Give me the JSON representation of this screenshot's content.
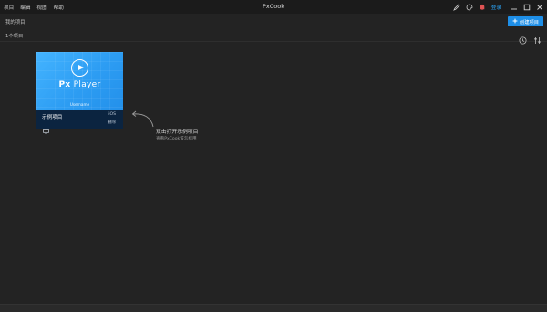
{
  "menu": [
    {
      "label": "项目"
    },
    {
      "label": "编辑"
    },
    {
      "label": "视图"
    },
    {
      "label": "帮助"
    }
  ],
  "window": {
    "title": "PxCook",
    "login_label": "登录"
  },
  "header": {
    "my_projects": "我的项目",
    "create_button": "创建项目"
  },
  "toolbar": {
    "count": "1个项目"
  },
  "project": {
    "thumb_title_bold": "Px",
    "thumb_title_rest": " Player",
    "thumb_subtitle": "Username",
    "name": "示例项目",
    "platform": "iOS",
    "delete": "删除"
  },
  "hint": {
    "title": "双击打开示例项目",
    "subtitle": "查看PxCook该怎样用"
  },
  "colors": {
    "accent": "#1e8fe8",
    "login": "#2aa2f4",
    "background": "#232323",
    "titlebar": "#1b1b1b",
    "card_footer": "#0b2440"
  },
  "icons": {
    "pen": "pen-icon",
    "palette": "palette-icon",
    "bell": "bell-icon",
    "minimize": "minimize-icon",
    "maximize": "maximize-icon",
    "close": "close-icon",
    "clock": "clock-icon",
    "sliders": "sliders-icon",
    "monitor": "monitor-icon",
    "home": "home-icon",
    "share": "share-icon"
  }
}
